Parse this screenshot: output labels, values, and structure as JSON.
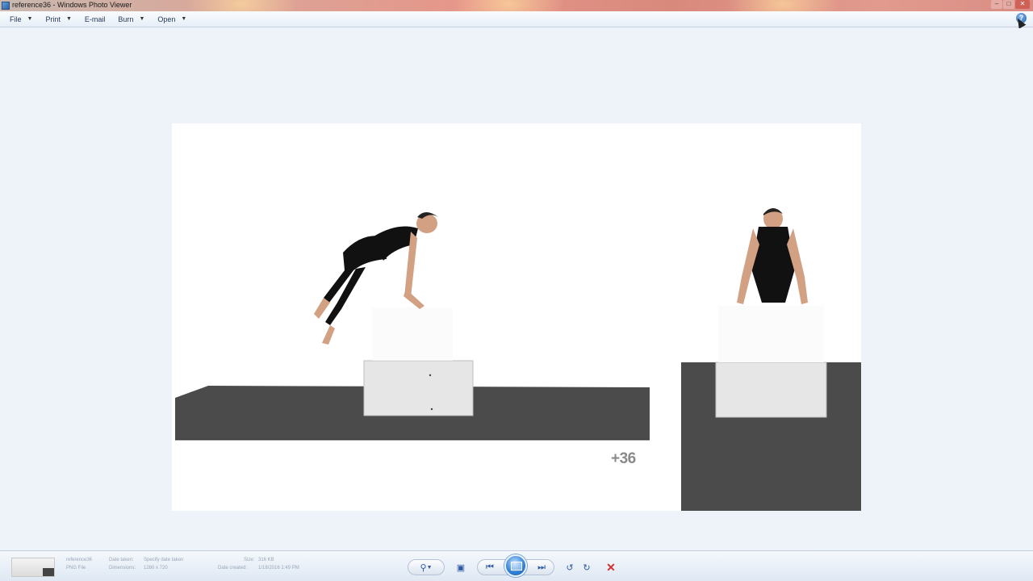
{
  "window": {
    "title": "reference36 - Windows Photo Viewer",
    "minimize_icon": "minimize-icon",
    "maximize_icon": "maximize-icon",
    "close_icon": "close-icon"
  },
  "menu": {
    "items": [
      {
        "label": "File",
        "icon": "chevron-down-icon"
      },
      {
        "label": "Print",
        "icon": "chevron-down-icon"
      },
      {
        "label": "E-mail"
      },
      {
        "label": "Burn",
        "icon": "chevron-down-icon"
      },
      {
        "label": "Open",
        "icon": "chevron-down-icon"
      }
    ],
    "help_icon": "help-icon"
  },
  "photo": {
    "counter_text": "+36",
    "colors": {
      "floor": "#4a4a4a",
      "box": "#e4e4e4",
      "figure": "#111111",
      "skin": "#d9a98a"
    }
  },
  "statusbar": {
    "filename": "reference36",
    "filetype": "PNG File",
    "date_taken_label": "Date taken:",
    "date_taken_value": "Specify date taken",
    "dimensions_label": "Dimensions:",
    "dimensions_value": "1280 x 720",
    "size_label": "Size:",
    "size_value": "316 KB",
    "date_created_label": "Date created:",
    "date_created_value": "1/18/2016 1:49 PM"
  },
  "toolbar": {
    "zoom_icon": "zoom-icon",
    "actual_size_icon": "actual-size-icon",
    "previous_icon": "previous-icon",
    "slideshow_icon": "slideshow-icon",
    "next_icon": "next-icon",
    "rotate_ccw_icon": "rotate-counterclockwise-icon",
    "rotate_cw_icon": "rotate-clockwise-icon",
    "delete_icon": "delete-icon"
  }
}
